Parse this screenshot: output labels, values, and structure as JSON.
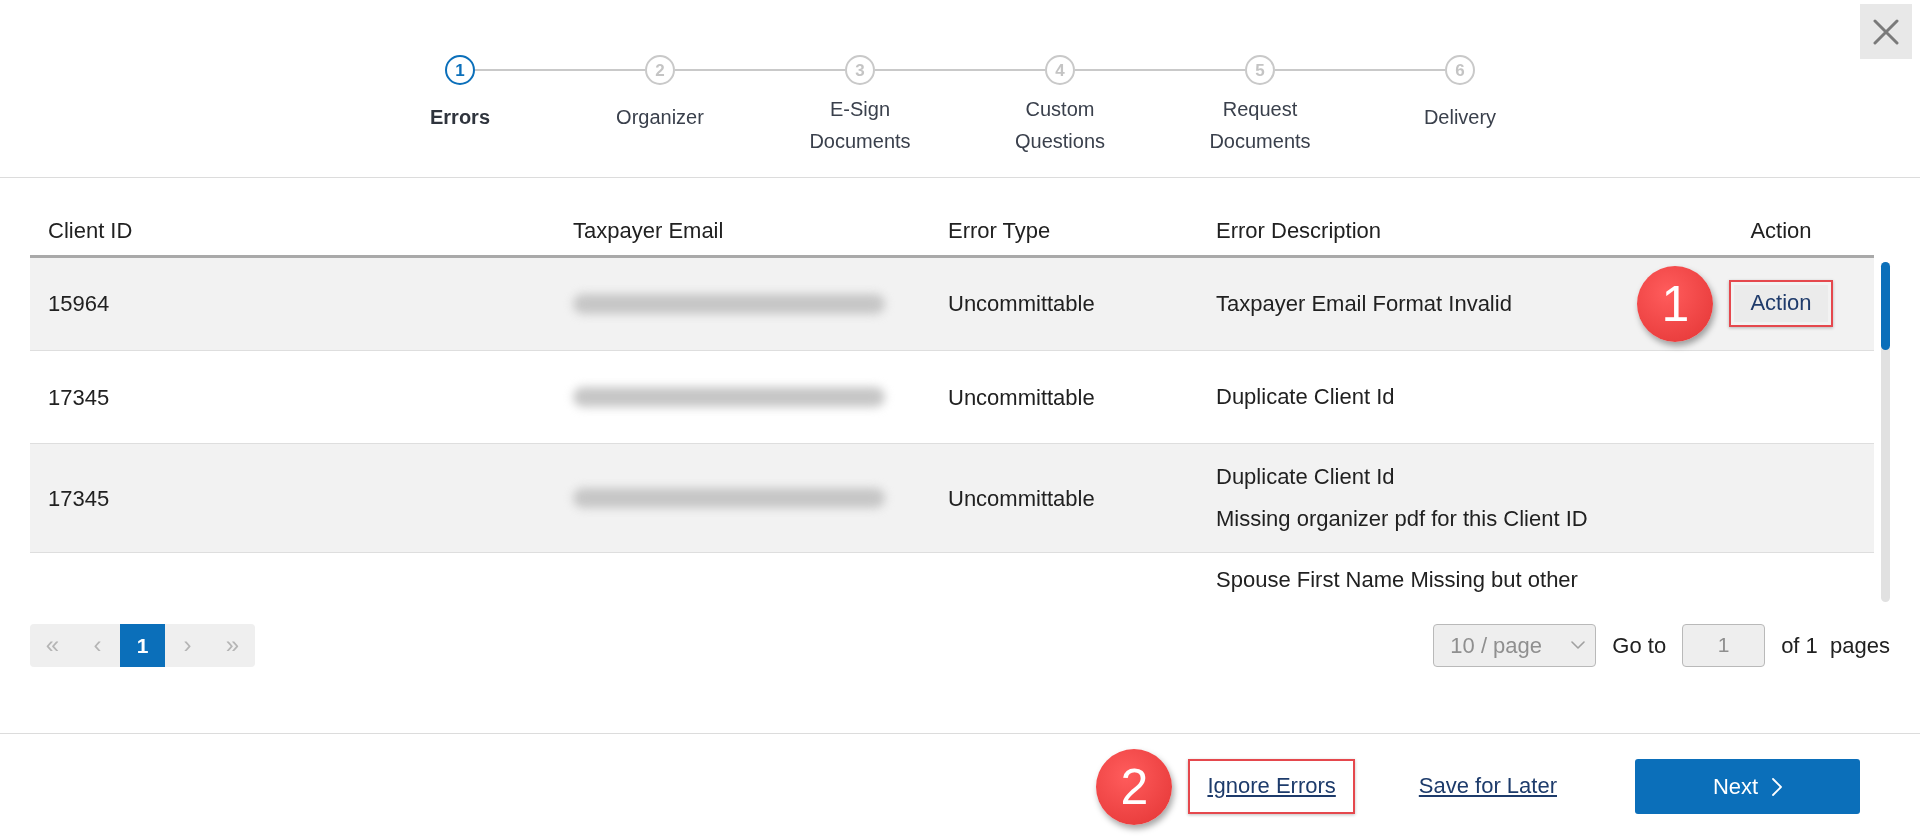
{
  "steps": [
    {
      "number": "1",
      "label": "Errors",
      "selected": true
    },
    {
      "number": "2",
      "label": "Organizer",
      "selected": false
    },
    {
      "number": "3",
      "label": "E-Sign Documents",
      "selected": false
    },
    {
      "number": "4",
      "label": "Custom Questions",
      "selected": false
    },
    {
      "number": "5",
      "label": "Request Documents",
      "selected": false
    },
    {
      "number": "6",
      "label": "Delivery",
      "selected": false
    }
  ],
  "table": {
    "columns": [
      "Client ID",
      "Taxpayer Email",
      "Error Type",
      "Error Description",
      "Action"
    ],
    "rows": [
      {
        "client_id": "15964",
        "email_blurred": true,
        "error_type": "Uncommittable",
        "errors": [
          "Taxpayer Email Format Invalid"
        ],
        "action": {
          "label": "Action",
          "callout": "1"
        }
      },
      {
        "client_id": "17345",
        "email_blurred": true,
        "error_type": "Uncommittable",
        "errors": [
          "Duplicate Client Id"
        ]
      },
      {
        "client_id": "17345",
        "email_blurred": true,
        "error_type": "Uncommittable",
        "errors": [
          "Duplicate Client Id",
          "Missing organizer pdf for this Client ID"
        ]
      },
      {
        "email_blurred": false,
        "errors": [
          "Spouse First Name Missing but other"
        ]
      }
    ]
  },
  "pagination": {
    "pages": [
      {
        "label": "«",
        "selected": false,
        "disabled": true
      },
      {
        "label": "‹",
        "selected": false,
        "disabled": true
      },
      {
        "label": "1",
        "selected": true,
        "disabled": false
      },
      {
        "label": "›",
        "selected": false,
        "disabled": true
      },
      {
        "label": "»",
        "selected": false,
        "disabled": true
      }
    ],
    "page_size": {
      "value": "10 / page",
      "disabled": true
    },
    "go_to": {
      "label": "Go to",
      "value": "1",
      "disabled": true
    },
    "page_count": "of 1  pages"
  },
  "footer": {
    "actions": [
      {
        "kind": "link",
        "label": "Ignore Errors",
        "callout": "2"
      },
      {
        "kind": "link",
        "label": "Save for Later"
      },
      {
        "kind": "primary",
        "label": "Next"
      }
    ]
  }
}
